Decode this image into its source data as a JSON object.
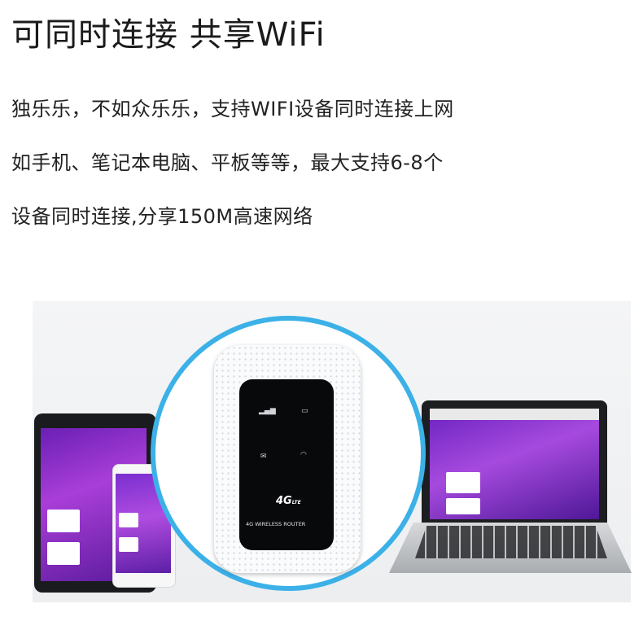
{
  "headline": "可同时连接 共享WiFi",
  "description": {
    "line1": "独乐乐，不如众乐乐，支持WIFI设备同时连接上网",
    "line2": "如手机、笔记本电脑、平板等等，最大支持6-8个",
    "line3": "设备同时连接,分享150M高速网络"
  },
  "device": {
    "logo": "4G",
    "logo_sub": "LTE",
    "label": "4G WIRELESS ROUTER"
  },
  "colors": {
    "circle_border": "#3cb1e8",
    "screen_purple": "#a93ed8"
  }
}
